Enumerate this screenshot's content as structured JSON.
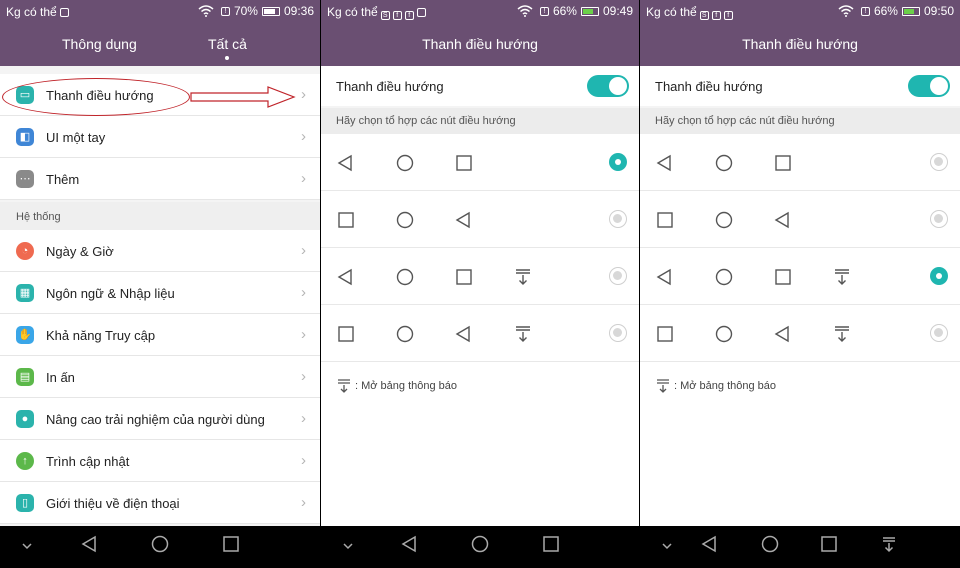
{
  "panel1": {
    "status": {
      "carrier": "Kg có thể",
      "battery": "70%",
      "time": "09:36"
    },
    "tabs": [
      {
        "label": "Thông dụng"
      },
      {
        "label": "Tất cả"
      }
    ],
    "items_top": [
      {
        "label": "Thanh điều hướng",
        "icon": "navigation-bar-icon",
        "color": "#2bb3ac"
      },
      {
        "label": "UI một tay",
        "icon": "one-hand-icon",
        "color": "#3f86d6"
      },
      {
        "label": "Thêm",
        "icon": "more-icon",
        "color": "#8a8a8a"
      }
    ],
    "section": "Hệ thống",
    "items_system": [
      {
        "label": "Ngày & Giờ",
        "icon": "clock-icon",
        "color": "#ef6a50"
      },
      {
        "label": "Ngôn ngữ & Nhập liệu",
        "icon": "keyboard-icon",
        "color": "#2bb3ac"
      },
      {
        "label": "Khả năng Truy cập",
        "icon": "hand-icon",
        "color": "#3aa6e8"
      },
      {
        "label": "In ấn",
        "icon": "printer-icon",
        "color": "#5cb84a"
      },
      {
        "label": "Nâng cao trải nghiệm của người dùng",
        "icon": "user-icon",
        "color": "#2bb3ac"
      },
      {
        "label": "Trình cập nhật",
        "icon": "update-arrow-icon",
        "color": "#5cb84a"
      },
      {
        "label": "Giới thiệu về điện thoại",
        "icon": "phone-info-icon",
        "color": "#2bb3ac"
      }
    ]
  },
  "panel2": {
    "status": {
      "carrier": "Kg có thể",
      "battery": "66%",
      "time": "09:49"
    },
    "title": "Thanh điều hướng",
    "toggle_label": "Thanh điều hướng",
    "toggle_on": true,
    "hint": "Hãy chọn tổ hợp các nút điều hướng",
    "options": [
      {
        "buttons": [
          "back",
          "home",
          "recent"
        ],
        "selected": true
      },
      {
        "buttons": [
          "recent",
          "home",
          "back"
        ],
        "selected": false
      },
      {
        "buttons": [
          "back",
          "home",
          "recent",
          "notification"
        ],
        "selected": false
      },
      {
        "buttons": [
          "recent",
          "home",
          "back",
          "notification"
        ],
        "selected": false
      }
    ],
    "legend": ": Mở bảng thông báo"
  },
  "panel3": {
    "status": {
      "carrier": "Kg có thể",
      "battery": "66%",
      "time": "09:50"
    },
    "title": "Thanh điều hướng",
    "toggle_label": "Thanh điều hướng",
    "toggle_on": true,
    "hint": "Hãy chọn tổ hợp các nút điều hướng",
    "options": [
      {
        "buttons": [
          "back",
          "home",
          "recent"
        ],
        "selected": false
      },
      {
        "buttons": [
          "recent",
          "home",
          "back"
        ],
        "selected": false
      },
      {
        "buttons": [
          "back",
          "home",
          "recent",
          "notification"
        ],
        "selected": true
      },
      {
        "buttons": [
          "recent",
          "home",
          "back",
          "notification"
        ],
        "selected": false
      }
    ],
    "legend": ": Mở bảng thông báo"
  },
  "colors": {
    "header": "#6a4f72",
    "accent": "#1fb6b0",
    "highlight": "#c0242a"
  }
}
